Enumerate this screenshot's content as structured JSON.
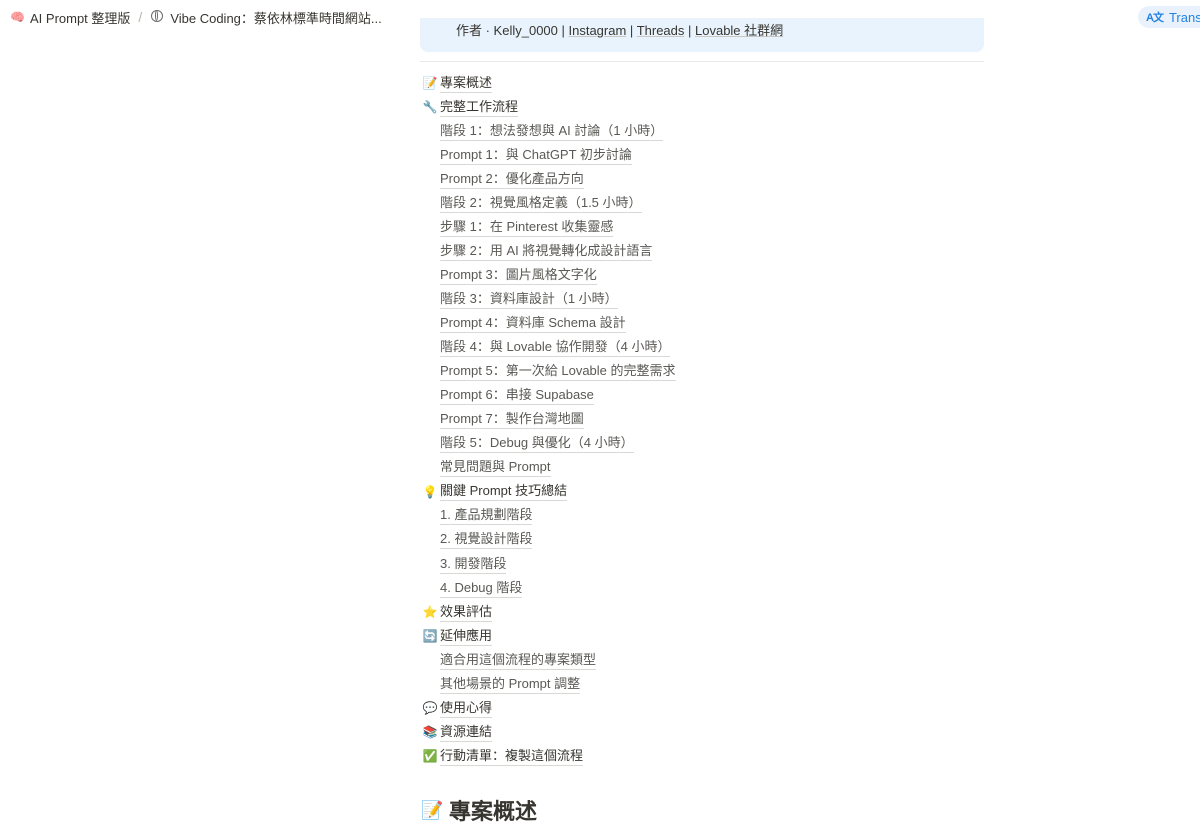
{
  "breadcrumb": {
    "items": [
      {
        "icon": "🧠",
        "label": "AI Prompt 整理版"
      },
      {
        "icon": "globe",
        "label": "Vibe Coding：蔡依林標準時間網站..."
      }
    ],
    "separator": "/"
  },
  "translate": {
    "icon": "A文",
    "label": "Translate"
  },
  "callout": {
    "prefix": "作者 · Kelly_0000 |",
    "links": [
      "Instagram",
      "Threads",
      "Lovable 社群網"
    ]
  },
  "toc": [
    {
      "level": 1,
      "icon": "📝",
      "label": "專案概述"
    },
    {
      "level": 1,
      "icon": "🔧",
      "label": "完整工作流程"
    },
    {
      "level": 2,
      "label": "階段 1：想法發想與 AI 討論（1 小時）"
    },
    {
      "level": 2,
      "label": "Prompt 1：與 ChatGPT 初步討論"
    },
    {
      "level": 2,
      "label": "Prompt 2：優化產品方向"
    },
    {
      "level": 2,
      "label": "階段 2：視覺風格定義（1.5 小時）"
    },
    {
      "level": 2,
      "label": "步驟 1：在 Pinterest 收集靈感"
    },
    {
      "level": 2,
      "label": "步驟 2：用 AI 將視覺轉化成設計語言"
    },
    {
      "level": 2,
      "label": "Prompt 3：圖片風格文字化"
    },
    {
      "level": 2,
      "label": "階段 3：資料庫設計（1 小時）"
    },
    {
      "level": 2,
      "label": "Prompt 4：資料庫 Schema 設計"
    },
    {
      "level": 2,
      "label": "階段 4：與 Lovable 協作開發（4 小時）"
    },
    {
      "level": 2,
      "label": "Prompt 5：第一次給 Lovable 的完整需求"
    },
    {
      "level": 2,
      "label": "Prompt 6：串接 Supabase"
    },
    {
      "level": 2,
      "label": "Prompt 7：製作台灣地圖"
    },
    {
      "level": 2,
      "label": "階段 5：Debug 與優化（4 小時）"
    },
    {
      "level": 2,
      "label": "常見問題與 Prompt"
    },
    {
      "level": 1,
      "icon": "💡",
      "label": "關鍵 Prompt 技巧總結"
    },
    {
      "level": 2,
      "label": "1. 產品規劃階段"
    },
    {
      "level": 2,
      "label": "2. 視覺設計階段"
    },
    {
      "level": 2,
      "label": "3. 開發階段"
    },
    {
      "level": 2,
      "label": "4. Debug 階段"
    },
    {
      "level": 1,
      "icon": "⭐",
      "label": "效果評估"
    },
    {
      "level": 1,
      "icon": "🔄",
      "label": "延伸應用"
    },
    {
      "level": 2,
      "label": "適合用這個流程的專案類型"
    },
    {
      "level": 2,
      "label": "其他場景的 Prompt 調整"
    },
    {
      "level": 1,
      "icon": "💬",
      "label": "使用心得"
    },
    {
      "level": 1,
      "icon": "📚",
      "label": "資源連結"
    },
    {
      "level": 1,
      "icon": "✅",
      "label": "行動清單：複製這個流程"
    }
  ],
  "section_heading": {
    "icon": "📝",
    "label": "專案概述"
  }
}
